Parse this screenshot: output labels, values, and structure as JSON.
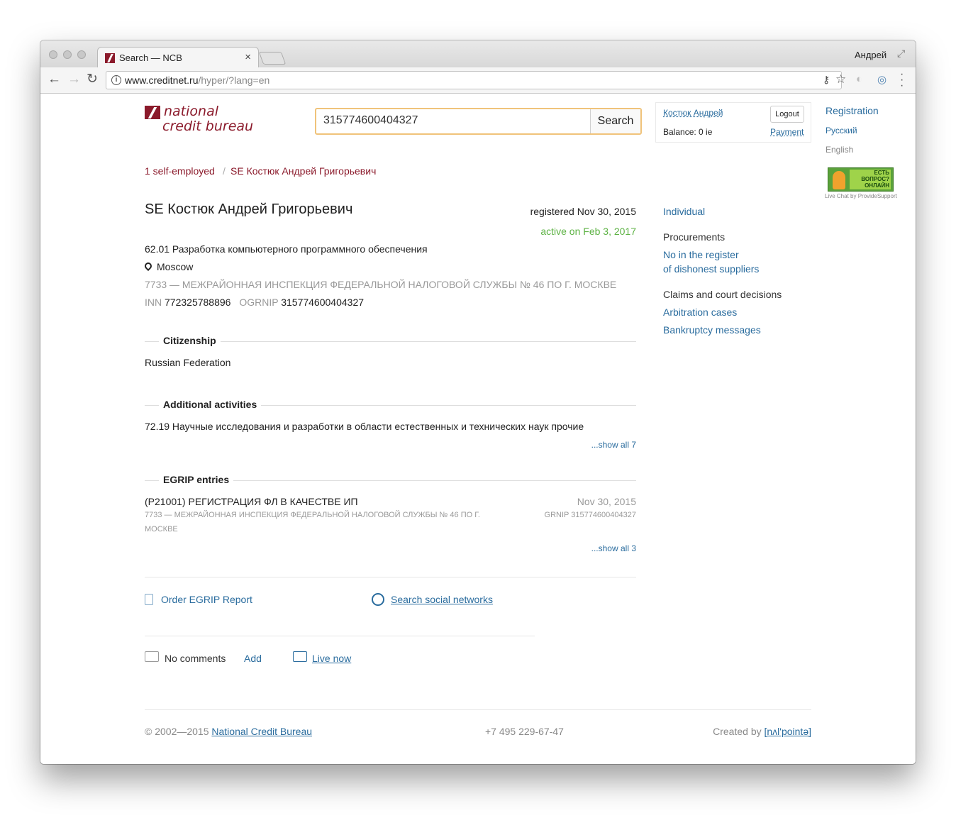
{
  "browser": {
    "tab_title": "Search — NCB",
    "tab_close": "×",
    "profile_name": "Андрей",
    "url_host": "www.creditnet.ru",
    "url_path": "/hyper/?lang=en"
  },
  "header": {
    "logo_line1": "national",
    "logo_line2": "credit bureau",
    "search_value": "315774600404327",
    "search_button": "Search",
    "account_name": "Костюк Андрей",
    "logout": "Logout",
    "balance": "Balance: 0 ie",
    "payment": "Payment"
  },
  "right_links": {
    "registration": "Registration",
    "russian": "Русский",
    "english": "English",
    "chat_badge": "ЕСТЬ ВОПРОС? ОНЛАЙН",
    "chat_caption": "Live Chat by ProvideSupport"
  },
  "breadcrumb": {
    "item1": "1 self-employed",
    "separator": "/",
    "item2": "SE Костюк Андрей Григорьевич"
  },
  "entity": {
    "title": "SE Костюк Андрей Григорьевич",
    "registered": "registered Nov 30, 2015",
    "status": "active on Feb 3, 2017",
    "activity": "62.01 Разработка компьютерного программного обеспечения",
    "city": "Moscow",
    "tax_office": "7733 — МЕЖРАЙОННАЯ ИНСПЕКЦИЯ ФЕДЕРАЛЬНОЙ НАЛОГОВОЙ СЛУЖБЫ № 46 ПО Г. МОСКВЕ",
    "inn_label": "INN",
    "inn": "772325788896",
    "ogrnip_label": "OGRNIP",
    "ogrnip": "315774600404327"
  },
  "citizenship": {
    "title": "Citizenship",
    "value": "Russian Federation"
  },
  "additional": {
    "title": "Additional activities",
    "value": "72.19 Научные исследования и разработки в области естественных и технических наук прочие",
    "show_all": "...show all 7"
  },
  "egrip": {
    "title": "EGRIP entries",
    "entry_title": "(Р21001) РЕГИСТРАЦИЯ ФЛ В КАЧЕСТВЕ ИП",
    "entry_date": "Nov 30, 2015",
    "entry_office_line1": "7733 — МЕЖРАЙОННАЯ ИНСПЕКЦИЯ ФЕДЕРАЛЬНОЙ НАЛОГОВОЙ СЛУЖБЫ № 46 ПО Г.",
    "entry_office_line2": "МОСКВЕ",
    "entry_grnip": "GRNIP 315774600404327",
    "show_all": "...show all 3"
  },
  "actions": {
    "order_report": "Order EGRIP Report",
    "search_social": "Search social networks",
    "no_comments": "No comments",
    "add": "Add",
    "live_now": "Live now"
  },
  "sidebar": {
    "individual": "Individual",
    "procurements": "Procurements",
    "register_line1": "No in the register",
    "register_line2": "of dishonest suppliers",
    "claims": "Claims and court decisions",
    "arbitration": "Arbitration cases",
    "bankruptcy": "Bankruptcy messages"
  },
  "footer": {
    "copyright": "© 2002—2015",
    "company": "National Credit Bureau",
    "phone": "+7 495 229-67-47",
    "created_by": "Created by",
    "creator": "[nʌl'pointə]"
  }
}
